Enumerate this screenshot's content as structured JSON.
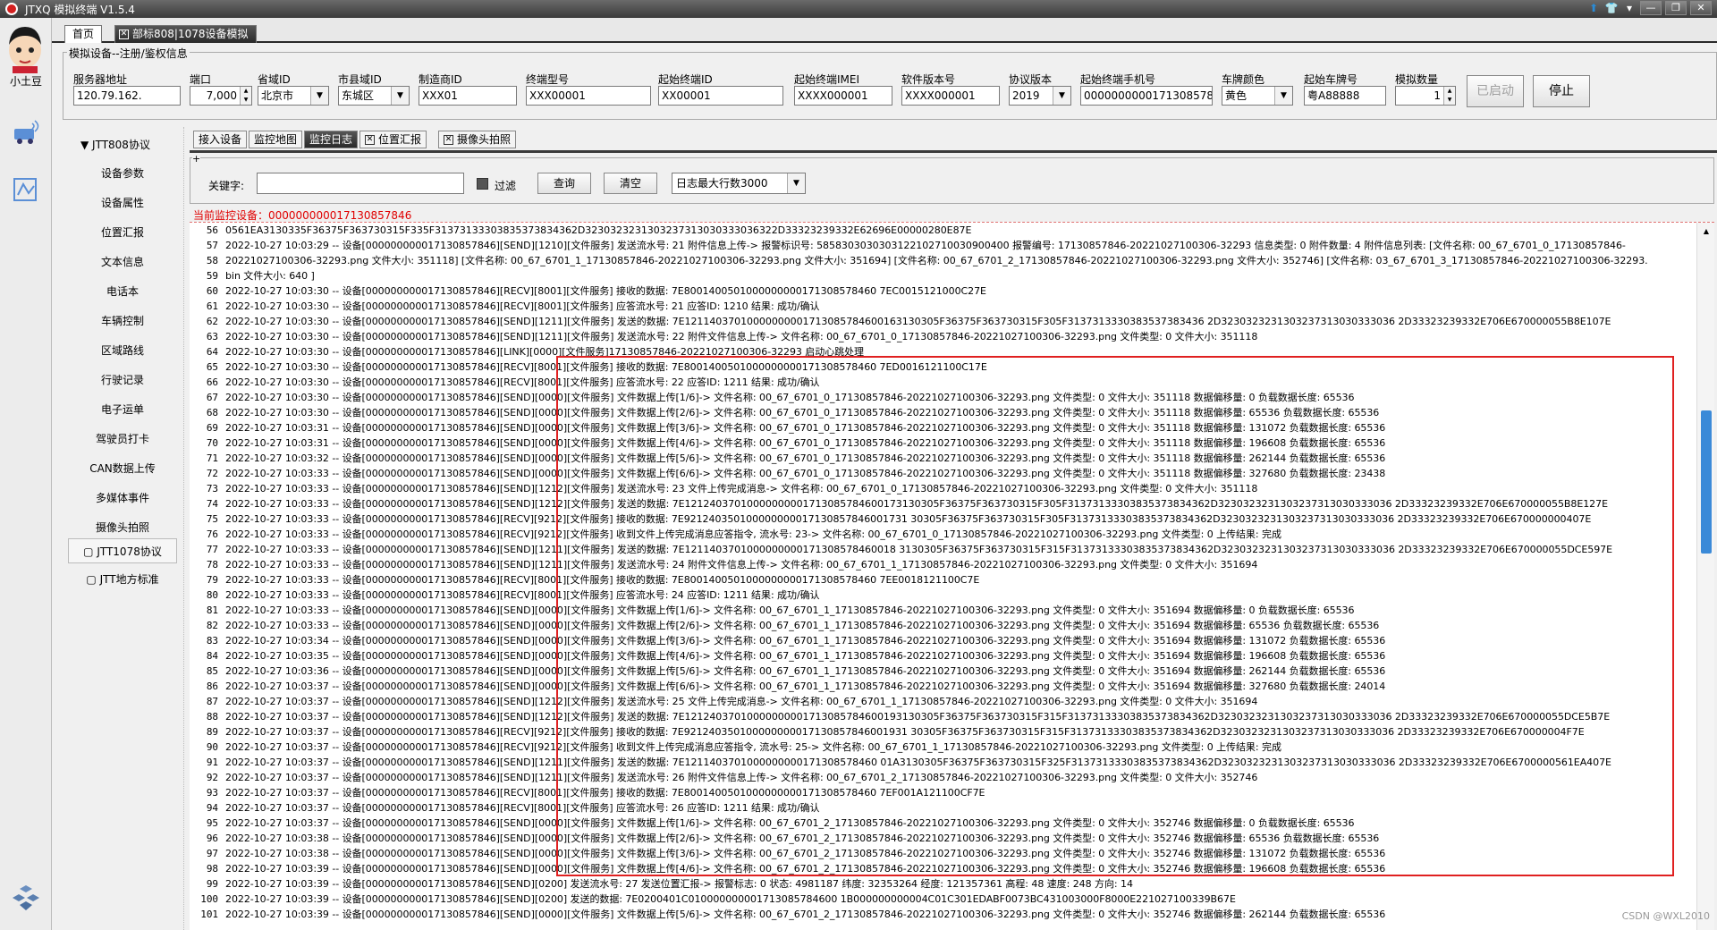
{
  "window": {
    "title": "JTXQ 模拟终端 V1.5.4"
  },
  "sidebar": {
    "user_label": "小土豆"
  },
  "tabs": {
    "home": "首页",
    "active": "部标808|1078设备模拟"
  },
  "register": {
    "legend": "模拟设备--注册/鉴权信息",
    "fields": [
      {
        "label": "服务器地址",
        "value": "120.79.162."
      },
      {
        "label": "端口",
        "value": "7,000"
      },
      {
        "label": "省域ID",
        "value": "北京市"
      },
      {
        "label": "市县域ID",
        "value": "东城区"
      },
      {
        "label": "制造商ID",
        "value": "XXX01"
      },
      {
        "label": "终端型号",
        "value": "XXX00001"
      },
      {
        "label": "起始终端ID",
        "value": "XX00001"
      },
      {
        "label": "起始终端IMEI",
        "value": "XXXX000001"
      },
      {
        "label": "软件版本号",
        "value": "XXXX000001"
      },
      {
        "label": "协议版本",
        "value": "2019"
      },
      {
        "label": "起始终端手机号",
        "value": "000000000017130857846"
      },
      {
        "label": "车牌颜色",
        "value": "黄色"
      },
      {
        "label": "起始车牌号",
        "value": "粤A88888"
      },
      {
        "label": "模拟数量",
        "value": "1"
      }
    ],
    "started_button": "已启动",
    "stop_button": "停止"
  },
  "protocol": {
    "jtt808": "JTT808协议",
    "items": [
      "设备参数",
      "设备属性",
      "位置汇报",
      "文本信息",
      "电话本",
      "车辆控制",
      "区域路线",
      "行驶记录",
      "电子运单",
      "驾驶员打卡",
      "CAN数据上传",
      "多媒体事件",
      "摄像头拍照"
    ],
    "jtt1078": "JTT1078协议",
    "local": "JTT地方标准"
  },
  "subtabs": [
    "接入设备",
    "监控地图",
    "监控日志",
    "位置汇报",
    "摄像头拍照"
  ],
  "filter": {
    "keyword_label": "关键字:",
    "keyword_value": "",
    "filter_label": "过滤",
    "query_button": "查询",
    "clear_button": "清空",
    "max_rows": "日志最大行数3000"
  },
  "current_device": "当前监控设备：000000000017130857846",
  "log": [
    {
      "n": "56",
      "t": "0561EA3130335F36375F363730315F335F31373133303835373834362D3230323231303237313030333036322D33323239332E62696E00000280E87E"
    },
    {
      "n": "57",
      "t": "2022-10-27 10:03:29 -- 设备[000000000017130857846][SEND][1210][文件服务] 发送流水号: 21 附件信息上传-> 报警标识号: 5858303030303122102710030900400 报警编号: 17130857846-20221027100306-32293 信息类型: 0 附件数量: 4 附件信息列表: [文件名称: 00_67_6701_0_17130857846-"
    },
    {
      "n": "58",
      "t": "20221027100306-32293.png 文件大小: 351118] [文件名称: 00_67_6701_1_17130857846-20221027100306-32293.png 文件大小: 351694] [文件名称: 00_67_6701_2_17130857846-20221027100306-32293.png 文件大小: 352746] [文件名称: 03_67_6701_3_17130857846-20221027100306-32293."
    },
    {
      "n": "59",
      "t": "bin 文件大小: 640 ]"
    },
    {
      "n": "60",
      "t": "2022-10-27 10:03:30 -- 设备[000000000017130857846][RECV][8001][文件服务] 接收的数据: 7E8001400501000000000171308578460 7EC0015121000C27E"
    },
    {
      "n": "61",
      "t": "2022-10-27 10:03:30 -- 设备[000000000017130857846][RECV][8001][文件服务] 应答流水号: 21 应答ID: 1210 结果: 成功/确认"
    },
    {
      "n": "62",
      "t": "2022-10-27 10:03:30 -- 设备[000000000017130857846][SEND][1211][文件服务] 发送的数据: 7E12114037010000000001713085784600163130305F36375F363730315F305F3137313330383537383436 2D3230323231303237313030333036 2D33323239332E706E670000055B8E107E"
    },
    {
      "n": "63",
      "t": "2022-10-27 10:03:30 -- 设备[000000000017130857846][SEND][1211][文件服务] 发送流水号: 22 附件文件信息上传-> 文件名称: 00_67_6701_0_17130857846-20221027100306-32293.png 文件类型: 0 文件大小: 351118"
    },
    {
      "n": "64",
      "t": "2022-10-27 10:03:30 -- 设备[000000000017130857846][LINK][0000][文件服务]17130857846-20221027100306-32293 启动心跳处理"
    },
    {
      "n": "65",
      "t": "2022-10-27 10:03:30 -- 设备[000000000017130857846][RECV][8001][文件服务] 接收的数据: 7E8001400501000000000171308578460 7ED0016121100C17E"
    },
    {
      "n": "66",
      "t": "2022-10-27 10:03:30 -- 设备[000000000017130857846][RECV][8001][文件服务] 应答流水号: 22 应答ID: 1211 结果: 成功/确认"
    },
    {
      "n": "67",
      "t": "2022-10-27 10:03:30 -- 设备[000000000017130857846][SEND][0000][文件服务] 文件数据上传[1/6]-> 文件名称: 00_67_6701_0_17130857846-20221027100306-32293.png 文件类型: 0 文件大小: 351118 数据偏移量: 0 负载数据长度: 65536"
    },
    {
      "n": "68",
      "t": "2022-10-27 10:03:30 -- 设备[000000000017130857846][SEND][0000][文件服务] 文件数据上传[2/6]-> 文件名称: 00_67_6701_0_17130857846-20221027100306-32293.png 文件类型: 0 文件大小: 351118 数据偏移量: 65536 负载数据长度: 65536"
    },
    {
      "n": "69",
      "t": "2022-10-27 10:03:31 -- 设备[000000000017130857846][SEND][0000][文件服务] 文件数据上传[3/6]-> 文件名称: 00_67_6701_0_17130857846-20221027100306-32293.png 文件类型: 0 文件大小: 351118 数据偏移量: 131072 负载数据长度: 65536"
    },
    {
      "n": "70",
      "t": "2022-10-27 10:03:31 -- 设备[000000000017130857846][SEND][0000][文件服务] 文件数据上传[4/6]-> 文件名称: 00_67_6701_0_17130857846-20221027100306-32293.png 文件类型: 0 文件大小: 351118 数据偏移量: 196608 负载数据长度: 65536"
    },
    {
      "n": "71",
      "t": "2022-10-27 10:03:32 -- 设备[000000000017130857846][SEND][0000][文件服务] 文件数据上传[5/6]-> 文件名称: 00_67_6701_0_17130857846-20221027100306-32293.png 文件类型: 0 文件大小: 351118 数据偏移量: 262144 负载数据长度: 65536"
    },
    {
      "n": "72",
      "t": "2022-10-27 10:03:33 -- 设备[000000000017130857846][SEND][0000][文件服务] 文件数据上传[6/6]-> 文件名称: 00_67_6701_0_17130857846-20221027100306-32293.png 文件类型: 0 文件大小: 351118 数据偏移量: 327680 负载数据长度: 23438"
    },
    {
      "n": "73",
      "t": "2022-10-27 10:03:33 -- 设备[000000000017130857846][SEND][1212][文件服务] 发送流水号: 23 文件上传完成消息-> 文件名称: 00_67_6701_0_17130857846-20221027100306-32293.png 文件类型: 0 文件大小: 351118"
    },
    {
      "n": "74",
      "t": "2022-10-27 10:03:33 -- 设备[000000000017130857846][SEND][1212][文件服务] 发送的数据: 7E12124037010000000001713085784600173130305F36375F363730315F305F31373133303835373834362D3230323231303237313030333036 2D33323239332E706E670000055B8E127E"
    },
    {
      "n": "75",
      "t": "2022-10-27 10:03:33 -- 设备[000000000017130857846][RECV][9212][文件服务] 接收的数据: 7E921240350100000000017130857846001731 30305F36375F363730315F305F31373133303835373834362D3230323231303237313030333036 2D33323239332E706E670000000407E"
    },
    {
      "n": "76",
      "t": "2022-10-27 10:03:33 -- 设备[000000000017130857846][RECV][9212][文件服务] 收到文件上传完成消息应答指令, 流水号: 23-> 文件名称: 00_67_6701_0_17130857846-20221027100306-32293.png 文件类型: 0 上传结果: 完成"
    },
    {
      "n": "77",
      "t": "2022-10-27 10:03:33 -- 设备[000000000017130857846][SEND][1211][文件服务] 发送的数据: 7E1211403701000000000171308578460018 3130305F36375F363730315F315F31373133303835373834362D3230323231303237313030333036 2D33323239332E706E670000055DCE597E"
    },
    {
      "n": "78",
      "t": "2022-10-27 10:03:33 -- 设备[000000000017130857846][SEND][1211][文件服务] 发送流水号: 24 附件文件信息上传-> 文件名称: 00_67_6701_1_17130857846-20221027100306-32293.png 文件类型: 0 文件大小: 351694"
    },
    {
      "n": "79",
      "t": "2022-10-27 10:03:33 -- 设备[000000000017130857846][RECV][8001][文件服务] 接收的数据: 7E8001400501000000000171308578460 7EE0018121100C7E"
    },
    {
      "n": "80",
      "t": "2022-10-27 10:03:33 -- 设备[000000000017130857846][RECV][8001][文件服务] 应答流水号: 24 应答ID: 1211 结果: 成功/确认"
    },
    {
      "n": "81",
      "t": "2022-10-27 10:03:33 -- 设备[000000000017130857846][SEND][0000][文件服务] 文件数据上传[1/6]-> 文件名称: 00_67_6701_1_17130857846-20221027100306-32293.png 文件类型: 0 文件大小: 351694 数据偏移量: 0 负载数据长度: 65536"
    },
    {
      "n": "82",
      "t": "2022-10-27 10:03:33 -- 设备[000000000017130857846][SEND][0000][文件服务] 文件数据上传[2/6]-> 文件名称: 00_67_6701_1_17130857846-20221027100306-32293.png 文件类型: 0 文件大小: 351694 数据偏移量: 65536 负载数据长度: 65536"
    },
    {
      "n": "83",
      "t": "2022-10-27 10:03:34 -- 设备[000000000017130857846][SEND][0000][文件服务] 文件数据上传[3/6]-> 文件名称: 00_67_6701_1_17130857846-20221027100306-32293.png 文件类型: 0 文件大小: 351694 数据偏移量: 131072 负载数据长度: 65536"
    },
    {
      "n": "84",
      "t": "2022-10-27 10:03:35 -- 设备[000000000017130857846][SEND][0000][文件服务] 文件数据上传[4/6]-> 文件名称: 00_67_6701_1_17130857846-20221027100306-32293.png 文件类型: 0 文件大小: 351694 数据偏移量: 196608 负载数据长度: 65536"
    },
    {
      "n": "85",
      "t": "2022-10-27 10:03:36 -- 设备[000000000017130857846][SEND][0000][文件服务] 文件数据上传[5/6]-> 文件名称: 00_67_6701_1_17130857846-20221027100306-32293.png 文件类型: 0 文件大小: 351694 数据偏移量: 262144 负载数据长度: 65536"
    },
    {
      "n": "86",
      "t": "2022-10-27 10:03:37 -- 设备[000000000017130857846][SEND][0000][文件服务] 文件数据上传[6/6]-> 文件名称: 00_67_6701_1_17130857846-20221027100306-32293.png 文件类型: 0 文件大小: 351694 数据偏移量: 327680 负载数据长度: 24014"
    },
    {
      "n": "87",
      "t": "2022-10-27 10:03:37 -- 设备[000000000017130857846][SEND][1212][文件服务] 发送流水号: 25 文件上传完成消息-> 文件名称: 00_67_6701_1_17130857846-20221027100306-32293.png 文件类型: 0 文件大小: 351694"
    },
    {
      "n": "88",
      "t": "2022-10-27 10:03:37 -- 设备[000000000017130857846][SEND][1212][文件服务] 发送的数据: 7E12124037010000000001713085784600193130305F36375F363730315F315F31373133303835373834362D3230323231303237313030333036 2D33323239332E706E670000055DCE5B7E"
    },
    {
      "n": "89",
      "t": "2022-10-27 10:03:37 -- 设备[000000000017130857846][RECV][9212][文件服务] 接收的数据: 7E921240350100000000017130857846001931 30305F36375F363730315F315F31373133303835373834362D3230323231303237313030333036 2D33323239332E706E670000004F7E"
    },
    {
      "n": "90",
      "t": "2022-10-27 10:03:37 -- 设备[000000000017130857846][RECV][9212][文件服务] 收到文件上传完成消息应答指令, 流水号: 25-> 文件名称: 00_67_6701_1_17130857846-20221027100306-32293.png 文件类型: 0 上传结果: 完成"
    },
    {
      "n": "91",
      "t": "2022-10-27 10:03:37 -- 设备[000000000017130857846][SEND][1211][文件服务] 发送的数据: 7E1211403701000000000171308578460 01A3130305F36375F363730315F325F31373133303835373834362D3230323231303237313030333036 2D33323239332E706E6700000561EA407E"
    },
    {
      "n": "92",
      "t": "2022-10-27 10:03:37 -- 设备[000000000017130857846][SEND][1211][文件服务] 发送流水号: 26 附件文件信息上传-> 文件名称: 00_67_6701_2_17130857846-20221027100306-32293.png 文件类型: 0 文件大小: 352746"
    },
    {
      "n": "93",
      "t": "2022-10-27 10:03:37 -- 设备[000000000017130857846][RECV][8001][文件服务] 接收的数据: 7E8001400501000000000171308578460 7EF001A121100CF7E"
    },
    {
      "n": "94",
      "t": "2022-10-27 10:03:37 -- 设备[000000000017130857846][RECV][8001][文件服务] 应答流水号: 26 应答ID: 1211 结果: 成功/确认"
    },
    {
      "n": "95",
      "t": "2022-10-27 10:03:37 -- 设备[000000000017130857846][SEND][0000][文件服务] 文件数据上传[1/6]-> 文件名称: 00_67_6701_2_17130857846-20221027100306-32293.png 文件类型: 0 文件大小: 352746 数据偏移量: 0 负载数据长度: 65536"
    },
    {
      "n": "96",
      "t": "2022-10-27 10:03:38 -- 设备[000000000017130857846][SEND][0000][文件服务] 文件数据上传[2/6]-> 文件名称: 00_67_6701_2_17130857846-20221027100306-32293.png 文件类型: 0 文件大小: 352746 数据偏移量: 65536 负载数据长度: 65536"
    },
    {
      "n": "97",
      "t": "2022-10-27 10:03:38 -- 设备[000000000017130857846][SEND][0000][文件服务] 文件数据上传[3/6]-> 文件名称: 00_67_6701_2_17130857846-20221027100306-32293.png 文件类型: 0 文件大小: 352746 数据偏移量: 131072 负载数据长度: 65536"
    },
    {
      "n": "98",
      "t": "2022-10-27 10:03:39 -- 设备[000000000017130857846][SEND][0000][文件服务] 文件数据上传[4/6]-> 文件名称: 00_67_6701_2_17130857846-20221027100306-32293.png 文件类型: 0 文件大小: 352746 数据偏移量: 196608 负载数据长度: 65536"
    },
    {
      "n": "99",
      "t": "2022-10-27 10:03:39 -- 设备[000000000017130857846][SEND][0200] 发送流水号: 27 发送位置汇报-> 报警标志: 0 状态: 4981187 纬度: 32353264 经度: 121357361 高程: 48 速度: 248 方向: 14"
    },
    {
      "n": "100",
      "t": "2022-10-27 10:03:39 -- 设备[000000000017130857846][SEND][0200] 发送的数据: 7E0200401C010000000001713085784600 1B000000000004C01C301EDABF0073BC431003000F8000E221027100339B67E"
    },
    {
      "n": "101",
      "t": "2022-10-27 10:03:39 -- 设备[000000000017130857846][SEND][0000][文件服务] 文件数据上传[5/6]-> 文件名称: 00_67_6701_2_17130857846-20221027100306-32293.png 文件类型: 0 文件大小: 352746 数据偏移量: 262144 负载数据长度: 65536"
    }
  ],
  "watermark": "CSDN @WXL2010"
}
